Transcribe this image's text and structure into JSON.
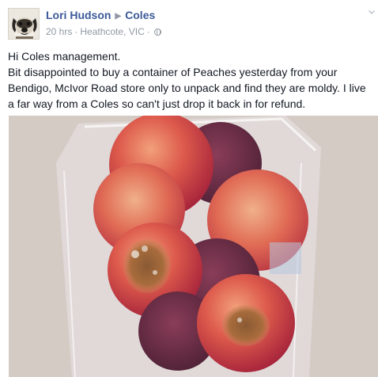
{
  "post": {
    "author": "Lori Hudson",
    "target_page": "Coles",
    "timestamp": "20 hrs",
    "location": "Heathcote, VIC",
    "privacy_icon": "globe-icon",
    "options_icon": "chevron-down-icon",
    "body_lines": [
      "Hi Coles management.",
      "Bit disappointed to buy a container of Peaches yesterday from your Bendigo, McIvor Road store only to unpack and find they are moldy. I live a far way from a Coles so can't just drop it back in for refund."
    ],
    "photo_subject": "moldy-peaches-in-plastic-container"
  },
  "colors": {
    "link": "#3b5998",
    "meta": "#9197a3",
    "text": "#141823"
  }
}
